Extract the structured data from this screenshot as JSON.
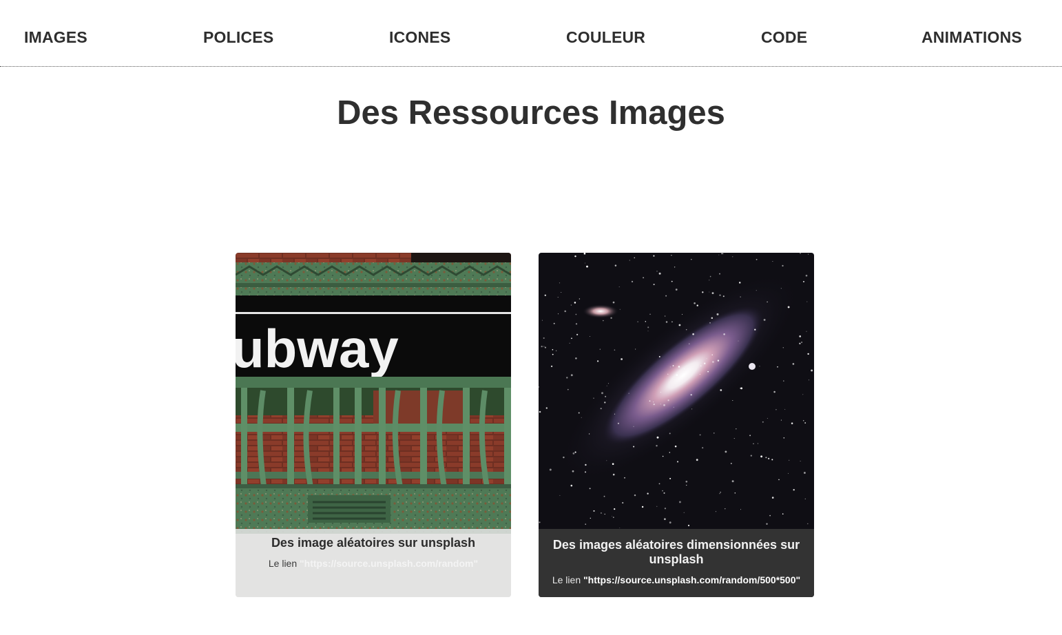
{
  "nav": {
    "items": [
      {
        "label": "IMAGES"
      },
      {
        "label": "POLICES"
      },
      {
        "label": "ICONES"
      },
      {
        "label": "COULEUR"
      },
      {
        "label": "CODE"
      },
      {
        "label": "ANIMATIONS"
      }
    ]
  },
  "page": {
    "title": "Des Ressources Images"
  },
  "cards": [
    {
      "image": "subway-sign-photo",
      "sign_text": "ubway",
      "title": "Des image aléatoires sur unsplash",
      "link_prefix": "Le lien",
      "link_url": "\"https://source.unsplash.com/random\""
    },
    {
      "image": "galaxy-photo",
      "title": "Des images aléatoires dimensionnées sur unsplash",
      "link_prefix": "Le lien",
      "link_url": "\"https://source.unsplash.com/random/500*500\""
    }
  ],
  "colors": {
    "text": "#2e2e2e",
    "caption_dark_bg": "#333333",
    "caption_light_bg": "#e4e4e4"
  }
}
